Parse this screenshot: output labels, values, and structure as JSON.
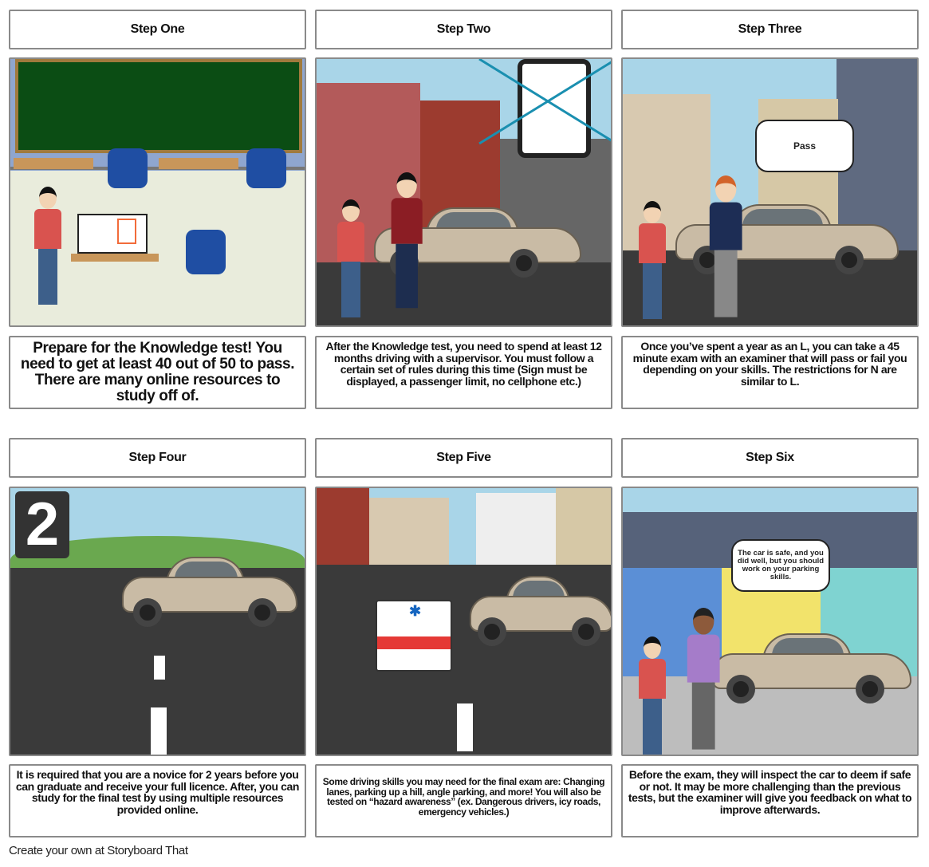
{
  "panels": [
    {
      "title": "Step One",
      "text": "Prepare for the Knowledge test! You need to get at least 40 out of 50 to pass. There are many online resources to study off of."
    },
    {
      "title": "Step Two",
      "text": "After the Knowledge test, you need to spend at least 12 months driving with a supervisor. You must follow a certain set of rules during this time (Sign must be displayed, a passenger limit, no cellphone etc.)"
    },
    {
      "title": "Step Three",
      "text": "Once you’ve spent a year as an L, you can take a 45 minute exam with an examiner that will pass or fail you depending on your skills. The restrictions for N are similar to L.",
      "speech": "Pass"
    },
    {
      "title": "Step Four",
      "text": "It is required that you are a novice for 2 years before you can graduate and receive your full licence. After, you can study for the final test by using multiple resources provided online.",
      "counter": "2"
    },
    {
      "title": "Step Five",
      "text": "Some driving skills you may need for the final exam are: Changing lanes, parking up a hill, angle parking, and more! You will also be tested on “hazard awareness” (ex. Dangerous drivers, icy roads, emergency vehicles.)"
    },
    {
      "title": "Step Six",
      "text": "Before the exam, they will inspect the car to deem if safe or not. It may be more challenging than the previous tests, but the examiner will give you feedback on what to improve afterwards.",
      "speech": "The car is safe, and you did well, but you should work on your parking skills."
    }
  ],
  "footer": "Create your own at Storyboard That"
}
